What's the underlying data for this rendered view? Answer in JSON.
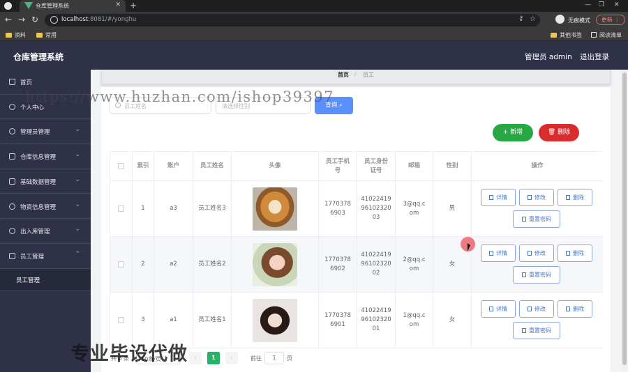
{
  "browser": {
    "tab_title": "仓库管理系统",
    "url_host": "localhost",
    "url_rest": ":8081/#/yonghu",
    "incognito_label": "无痕模式",
    "update_label": "更新",
    "bookmarks": [
      "资料",
      "常用"
    ],
    "bookmarks_right": [
      "其他书签",
      "阅读清单"
    ]
  },
  "header": {
    "title": "仓库管理系统",
    "user": "管理员 admin",
    "logout": "退出登录"
  },
  "sidebar": {
    "items": [
      {
        "label": "首页"
      },
      {
        "label": "个人中心"
      },
      {
        "label": "管理员管理"
      },
      {
        "label": "仓库信息管理"
      },
      {
        "label": "基础数据管理"
      },
      {
        "label": "物资信息管理"
      },
      {
        "label": "出入库管理"
      },
      {
        "label": "员工管理"
      }
    ],
    "subitem": "员工管理"
  },
  "breadcrumb": {
    "home": "首页",
    "current": "员工"
  },
  "search": {
    "name_placeholder": "员工姓名",
    "gender_placeholder": "请选择性别",
    "query_label": "查询"
  },
  "actions": {
    "add": "新增",
    "delete": "删除"
  },
  "table": {
    "headers": [
      "索引",
      "账户",
      "员工姓名",
      "头像",
      "员工手机号",
      "员工身份证号",
      "邮箱",
      "性别",
      "操作"
    ],
    "rows": [
      {
        "index": "1",
        "account": "a3",
        "name": "员工姓名3",
        "avatar": "dog",
        "phone": "17703786903",
        "id_no": "410224199610232003",
        "email": "3@qq.com",
        "gender": "男"
      },
      {
        "index": "2",
        "account": "a2",
        "name": "员工姓名2",
        "avatar": "woman1",
        "phone": "17703786902",
        "id_no": "410224199610232002",
        "email": "2@qq.com",
        "gender": "女"
      },
      {
        "index": "3",
        "account": "a1",
        "name": "员工姓名1",
        "avatar": "woman2",
        "phone": "17703786901",
        "id_no": "410224199610232001",
        "email": "1@qq.com",
        "gender": "女"
      }
    ],
    "ops": {
      "detail": "详情",
      "edit": "修改",
      "delete": "删除",
      "reset": "重置密码"
    }
  },
  "pager": {
    "total": "共 3 条",
    "size": "10条/页",
    "current": "1",
    "goto": "前往",
    "goto_value": "1",
    "page": "页"
  },
  "overlays": {
    "watermark": "https://www.huzhan.com/ishop39397",
    "caption": "专业毕设代做"
  }
}
